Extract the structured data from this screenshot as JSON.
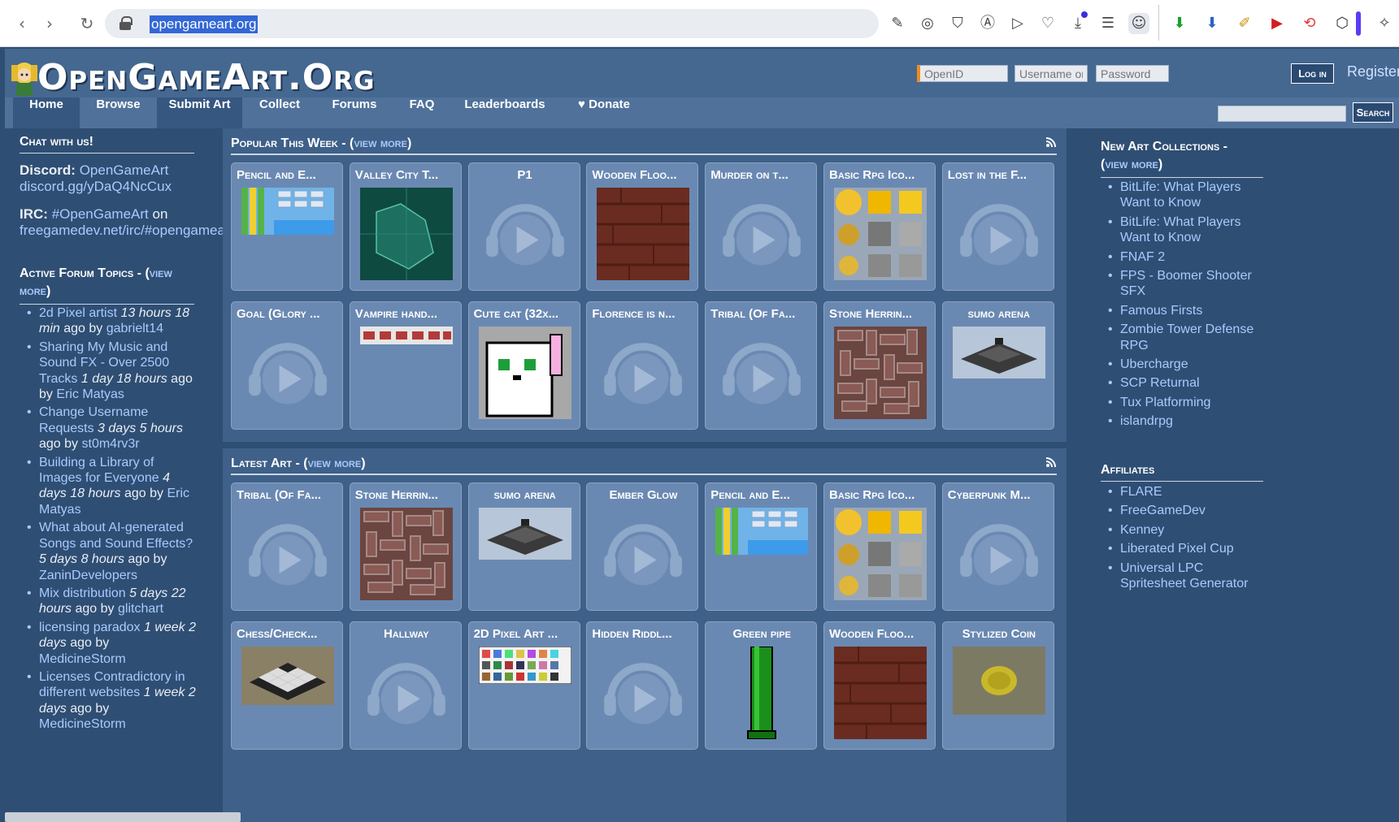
{
  "browser": {
    "url": "opengameart.org"
  },
  "site": {
    "logo": "OpenGameArt.Org",
    "login": {
      "openid_placeholder": "OpenID",
      "username_placeholder": "Username or",
      "password_placeholder": "Password",
      "login_label": "Log in",
      "register_label": "Register"
    },
    "nav": [
      {
        "label": "Home"
      },
      {
        "label": "Browse"
      },
      {
        "label": "Submit Art"
      },
      {
        "label": "Collect"
      },
      {
        "label": "Forums"
      },
      {
        "label": "FAQ"
      },
      {
        "label": "Leaderboards"
      },
      {
        "label": "Donate"
      }
    ],
    "search_label": "Search"
  },
  "left": {
    "chat_heading": "Chat with us!",
    "discord_label": "Discord:",
    "discord_name": "OpenGameArt",
    "discord_url": "discord.gg/yDaQ4NcCux",
    "irc_label": "IRC:",
    "irc_channel": "#OpenGameArt",
    "irc_on": "on",
    "irc_url": "freegamedev.net/irc/#opengameart",
    "forum_heading": "Active Forum Topics - (",
    "forum_view": "view more",
    "forum_heading_end": ")",
    "topics": [
      {
        "title": "2d Pixel artist",
        "time": "13 hours 18 min",
        "ago": "ago by",
        "user": "gabrielt14"
      },
      {
        "title": "Sharing My Music and Sound FX - Over 2500 Tracks",
        "time": "1 day 18 hours",
        "ago": "ago by",
        "user": "Eric Matyas"
      },
      {
        "title": "Change Username Requests",
        "time": "3 days 5 hours",
        "ago": "ago by",
        "user": "st0m4rv3r"
      },
      {
        "title": "Building a Library of Images for Everyone",
        "time": "4 days 18 hours",
        "ago": "ago by",
        "user": "Eric Matyas"
      },
      {
        "title": "What about AI-generated Songs and Sound Effects?",
        "time": "5 days 8 hours",
        "ago": "ago by",
        "user": "ZaninDevelopers"
      },
      {
        "title": "Mix distribution",
        "time": "5 days 22 hours",
        "ago": "ago by",
        "user": "glitchart"
      },
      {
        "title": "licensing paradox",
        "time": "1 week 2 days",
        "ago": "ago by",
        "user": "MedicineStorm"
      },
      {
        "title": "Licenses Contradictory in different websites",
        "time": "1 week 2 days",
        "ago": "ago by",
        "user": "MedicineStorm"
      }
    ]
  },
  "popular": {
    "heading": "Popular This Week - (",
    "view_more": "view more",
    "heading_end": ")",
    "tiles": [
      {
        "title": "Pencil and E...",
        "thumb": "pencil"
      },
      {
        "title": "Valley City T...",
        "thumb": "map"
      },
      {
        "title": "P1",
        "thumb": "audio",
        "center": true
      },
      {
        "title": "Wooden Floo...",
        "thumb": "wood"
      },
      {
        "title": "Murder on t...",
        "thumb": "audio"
      },
      {
        "title": "Basic Rpg Ico...",
        "thumb": "icons"
      },
      {
        "title": "Lost in the F...",
        "thumb": "audio"
      },
      {
        "title": "Goal (Glory ...",
        "thumb": "audio"
      },
      {
        "title": "Vampire hand...",
        "thumb": "vampire"
      },
      {
        "title": "Cute cat (32x...",
        "thumb": "cat"
      },
      {
        "title": "Florence is n...",
        "thumb": "audio"
      },
      {
        "title": "Tribal (Of Fa...",
        "thumb": "audio"
      },
      {
        "title": "Stone Herrin...",
        "thumb": "herring"
      },
      {
        "title": "sumo arena",
        "thumb": "sumo",
        "center": true
      }
    ]
  },
  "latest": {
    "heading": "Latest Art - (",
    "view_more": "view more",
    "heading_end": ")",
    "tiles": [
      {
        "title": "Tribal (Of Fa...",
        "thumb": "audio"
      },
      {
        "title": "Stone Herrin...",
        "thumb": "herring"
      },
      {
        "title": "sumo arena",
        "thumb": "sumo",
        "center": true
      },
      {
        "title": "Ember Glow",
        "thumb": "audio",
        "center": true
      },
      {
        "title": "Pencil and E...",
        "thumb": "pencil"
      },
      {
        "title": "Basic Rpg Ico...",
        "thumb": "icons"
      },
      {
        "title": "Cyberpunk M...",
        "thumb": "audio"
      },
      {
        "title": "Chess/Check...",
        "thumb": "chess"
      },
      {
        "title": "Hallway",
        "thumb": "audio",
        "center": true
      },
      {
        "title": "2D Pixel Art ...",
        "thumb": "pixelart"
      },
      {
        "title": "Hidden Riddl...",
        "thumb": "audio"
      },
      {
        "title": "Green pipe",
        "thumb": "pipe",
        "center": true
      },
      {
        "title": "Wooden Floo...",
        "thumb": "wood"
      },
      {
        "title": "Stylized Coin",
        "thumb": "coin",
        "center": true
      }
    ]
  },
  "right": {
    "collections_heading": "New Art Collections -",
    "collections_open": "(",
    "collections_view": "view more",
    "collections_close": ")",
    "collections": [
      "BitLife: What Players Want to Know",
      "BitLife: What Players Want to Know",
      "FNAF 2",
      "FPS - Boomer Shooter SFX",
      "Famous Firsts",
      "Zombie Tower Defense RPG",
      "Ubercharge",
      "SCP Returnal",
      "Tux Platforming",
      "islandrpg"
    ],
    "affiliates_heading": "Affiliates",
    "affiliates": [
      "FLARE",
      "FreeGameDev",
      "Kenney",
      "Liberated Pixel Cup",
      "Universal LPC Spritesheet Generator"
    ]
  },
  "colors": {
    "page_bg": "#2f4e73",
    "header_bg": "#456891",
    "tile_bg": "#6a89b2",
    "link": "#a9caff"
  }
}
